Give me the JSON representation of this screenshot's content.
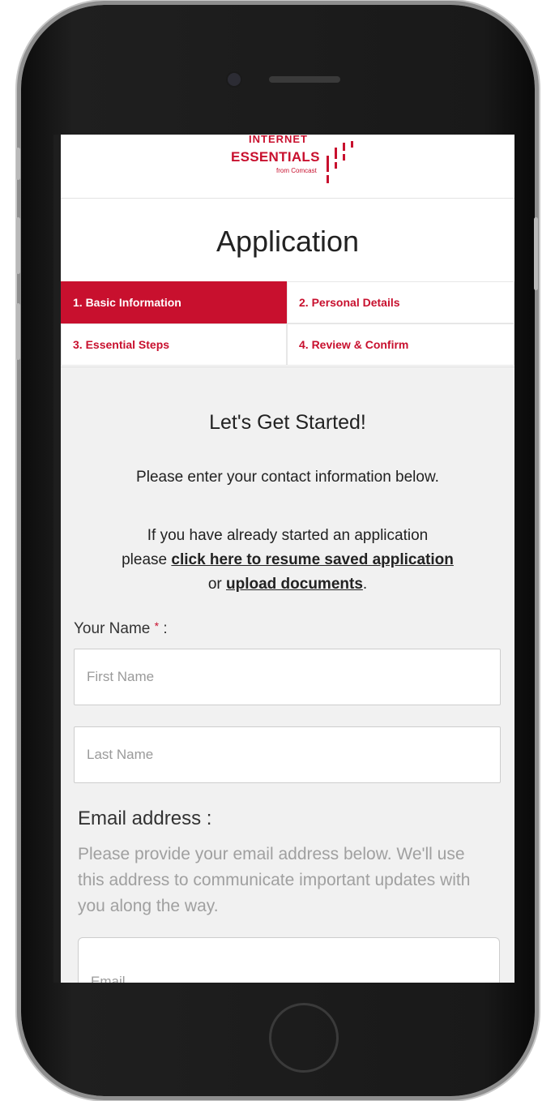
{
  "logo": {
    "top_text": "INTERNET",
    "main_text": "ESSENTIALS",
    "sub_text": "from Comcast",
    "bars_icon": "signal-bars-icon"
  },
  "page": {
    "title": "Application"
  },
  "tabs": [
    {
      "label": "1. Basic Information",
      "active": true
    },
    {
      "label": "2. Personal Details",
      "active": false
    },
    {
      "label": "3. Essential Steps",
      "active": false
    },
    {
      "label": "4. Review & Confirm",
      "active": false
    }
  ],
  "form": {
    "heading": "Let's Get Started!",
    "intro": "Please enter your contact information below.",
    "resume_prefix": "If you have already started an application",
    "resume_please": "please",
    "resume_link": "click here to resume saved application",
    "resume_or": "or",
    "upload_link": "upload documents",
    "resume_period": ".",
    "name_label": "Your Name",
    "required_mark": "*",
    "name_colon": ":",
    "first_name_placeholder": "First Name",
    "last_name_placeholder": "Last Name",
    "email_label": "Email address :",
    "email_help": "Please provide your email address below. We'll use this address to communicate important updates with you along the way.",
    "email_placeholder": "Email"
  },
  "colors": {
    "brand": "#c8102e",
    "background": "#f1f1f1"
  }
}
